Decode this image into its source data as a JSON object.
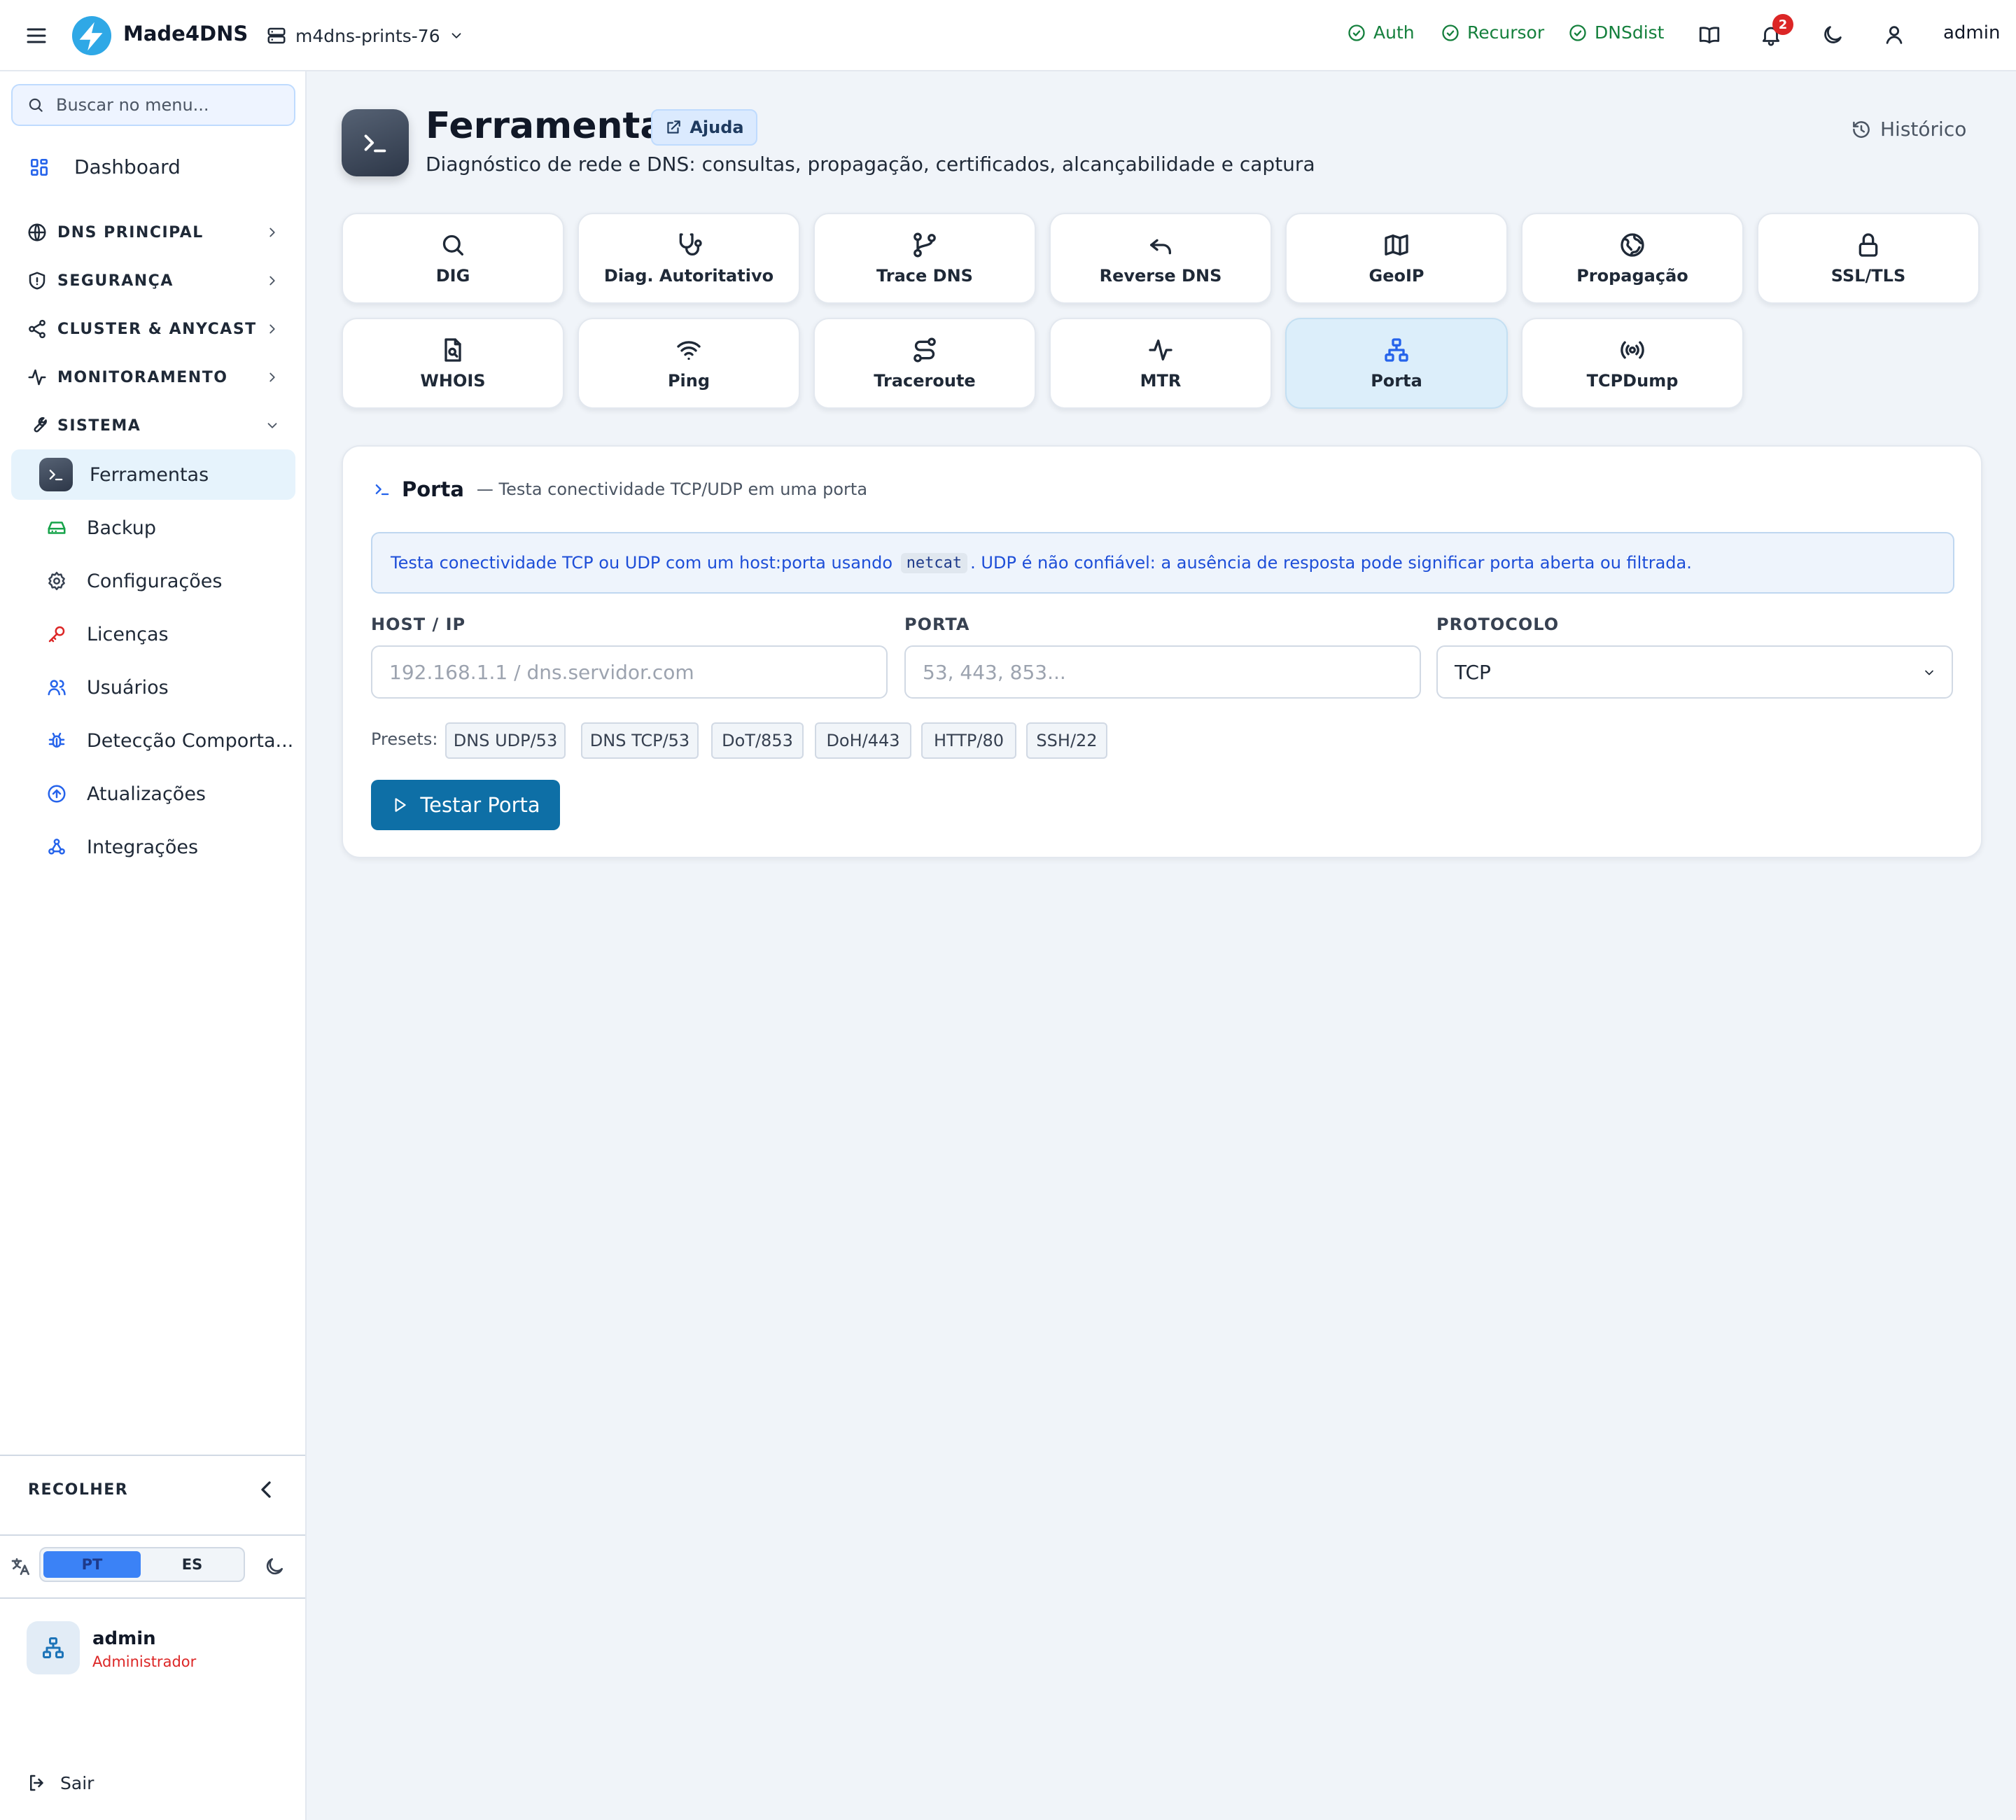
{
  "header": {
    "brand": "Made4DNS",
    "server": "m4dns-prints-76",
    "services": [
      {
        "label": "Auth",
        "status": "ok"
      },
      {
        "label": "Recursor",
        "status": "ok"
      },
      {
        "label": "DNSdist",
        "status": "ok"
      }
    ],
    "notifications_count": "2",
    "user": "admin",
    "colors": {
      "ok": "#15803d",
      "badge": "#dc2626",
      "accent": "#0e6fa6"
    }
  },
  "sidebar": {
    "search_placeholder": "Buscar no menu...",
    "dashboard": "Dashboard",
    "sections": [
      {
        "label": "DNS PRINCIPAL",
        "icon": "globe-icon",
        "expanded": false
      },
      {
        "label": "SEGURANÇA",
        "icon": "shield-icon",
        "expanded": false
      },
      {
        "label": "CLUSTER & ANYCAST",
        "icon": "share-icon",
        "expanded": false
      },
      {
        "label": "MONITORAMENTO",
        "icon": "activity-icon",
        "expanded": false
      },
      {
        "label": "SISTEMA",
        "icon": "wrench-icon",
        "expanded": true
      }
    ],
    "items": [
      {
        "label": "Ferramentas",
        "icon": "terminal-icon",
        "active": true
      },
      {
        "label": "Backup",
        "icon": "hard-drive-icon"
      },
      {
        "label": "Configurações",
        "icon": "gear-icon"
      },
      {
        "label": "Licenças",
        "icon": "key-icon"
      },
      {
        "label": "Usuários",
        "icon": "users-icon"
      },
      {
        "label": "Detecção Comporta...",
        "icon": "bug-icon"
      },
      {
        "label": "Atualizações",
        "icon": "arrow-up-circle-icon"
      },
      {
        "label": "Integrações",
        "icon": "webhook-icon"
      }
    ],
    "collapse_label": "RECOLHER",
    "languages": [
      {
        "code": "PT",
        "selected": true
      },
      {
        "code": "ES",
        "selected": false
      }
    ],
    "user": {
      "name": "admin",
      "role": "Administrador"
    },
    "logout": "Sair"
  },
  "page": {
    "title": "Ferramentas",
    "help": "Ajuda",
    "subtitle": "Diagnóstico de rede e DNS: consultas, propagação, certificados, alcançabilidade e captura",
    "history": "Histórico"
  },
  "tools": [
    {
      "label": "DIG",
      "icon": "search-icon"
    },
    {
      "label": "Diag. Autoritativo",
      "icon": "stethoscope-icon"
    },
    {
      "label": "Trace DNS",
      "icon": "git-branch-icon"
    },
    {
      "label": "Reverse DNS",
      "icon": "undo-icon"
    },
    {
      "label": "GeoIP",
      "icon": "map-icon"
    },
    {
      "label": "Propagação",
      "icon": "globe-icon"
    },
    {
      "label": "SSL/TLS",
      "icon": "lock-icon"
    },
    {
      "label": "WHOIS",
      "icon": "file-search-icon"
    },
    {
      "label": "Ping",
      "icon": "wifi-icon"
    },
    {
      "label": "Traceroute",
      "icon": "route-icon"
    },
    {
      "label": "MTR",
      "icon": "activity-icon"
    },
    {
      "label": "Porta",
      "icon": "network-icon",
      "active": true
    },
    {
      "label": "TCPDump",
      "icon": "radio-icon"
    }
  ],
  "panel": {
    "title": "Porta",
    "description": "— Testa conectividade TCP/UDP em uma porta",
    "info_before": "Testa conectividade TCP ou UDP com um host:porta usando",
    "info_code": "netcat",
    "info_after": ". UDP é não confiável: a ausência de resposta pode significar porta aberta ou filtrada.",
    "host_label": "HOST / IP",
    "host_placeholder": "192.168.1.1 / dns.servidor.com",
    "port_label": "PORTA",
    "port_placeholder": "53, 443, 853...",
    "protocol_label": "PROTOCOLO",
    "protocol_value": "TCP",
    "presets_label": "Presets:",
    "presets": [
      "DNS UDP/53",
      "DNS TCP/53",
      "DoT/853",
      "DoH/443",
      "HTTP/80",
      "SSH/22"
    ],
    "run_button": "Testar Porta"
  }
}
